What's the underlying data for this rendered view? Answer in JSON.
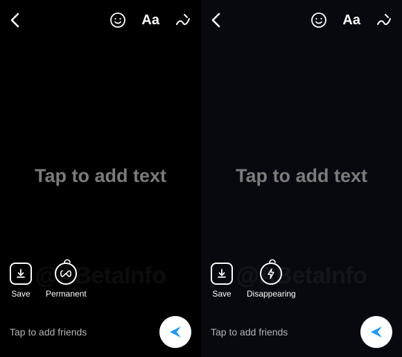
{
  "panes": [
    {
      "canvas_placeholder": "Tap to add text",
      "actions": {
        "save_label": "Save",
        "mode_label": "Permanent"
      },
      "bottom_hint": "Tap to add friends",
      "watermark": "@ABetaInfo"
    },
    {
      "canvas_placeholder": "Tap to add text",
      "actions": {
        "save_label": "Save",
        "mode_label": "Disappearing"
      },
      "bottom_hint": "Tap to add friends",
      "watermark": "@ABetaInfo"
    }
  ],
  "text_tool_label": "Aa"
}
